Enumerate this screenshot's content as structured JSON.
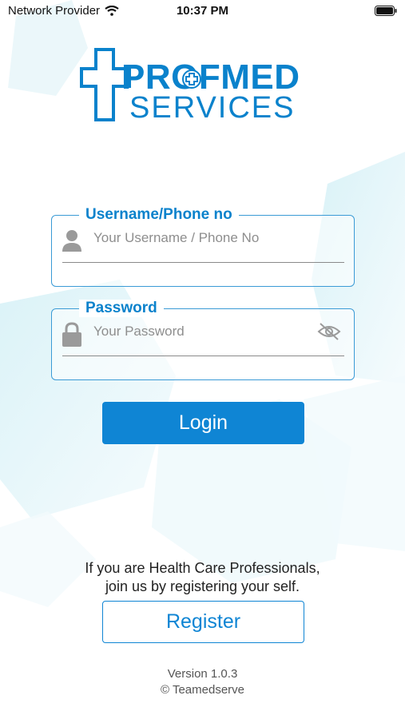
{
  "status_bar": {
    "carrier": "Network Provider",
    "time": "10:37 PM"
  },
  "logo": {
    "line1": "PROFMED",
    "line2": "SERVICES"
  },
  "username_field": {
    "label": "Username/Phone no",
    "placeholder": "Your Username / Phone No",
    "value": ""
  },
  "password_field": {
    "label": "Password",
    "placeholder": "Your Password",
    "value": ""
  },
  "login_button": {
    "label": "Login"
  },
  "register_note": {
    "line1": "If you are Health Care Professionals,",
    "line2": "join us by registering your self."
  },
  "register_button": {
    "label": "Register"
  },
  "footer": {
    "version": "Version 1.0.3",
    "copyright": "© Teamedserve"
  },
  "colors": {
    "brand": "#0a82cc",
    "button": "#0f85d4",
    "field_border": "#3b9bd6"
  },
  "icons": {
    "user": "user-icon",
    "lock": "lock-icon",
    "eye": "eye-slash-icon",
    "wifi": "wifi-icon",
    "battery": "battery-icon"
  }
}
